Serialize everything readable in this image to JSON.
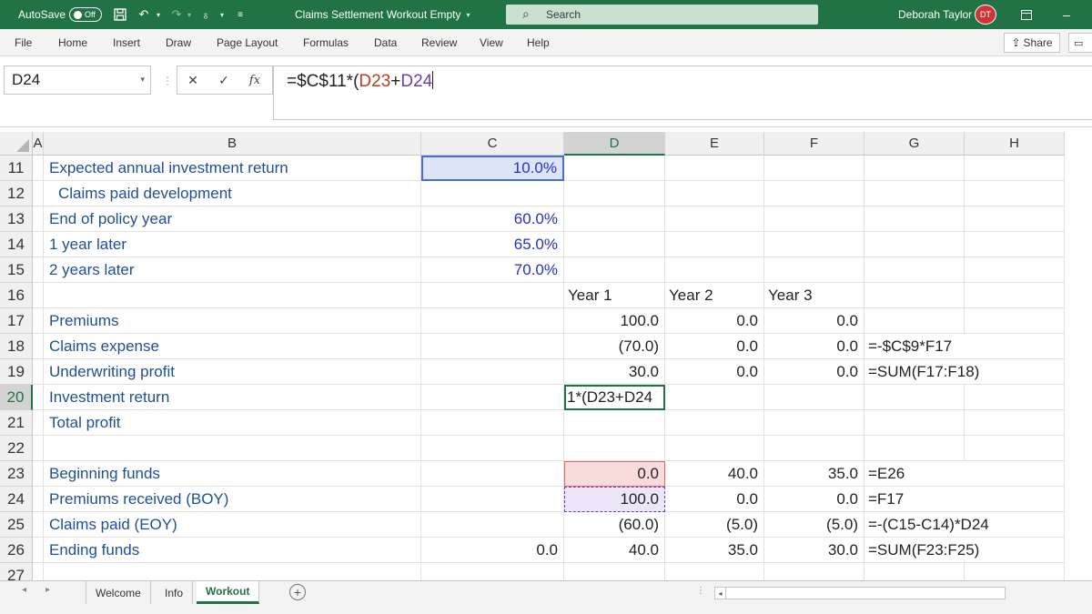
{
  "title_bar": {
    "autosave_label": "AutoSave",
    "autosave_state": "Off",
    "document_title": "Claims Settlement Workout Empty",
    "search_placeholder": "Search",
    "user_name": "Deborah Taylor",
    "user_initials": "DT"
  },
  "menu": {
    "items": [
      "File",
      "Home",
      "Insert",
      "Draw",
      "Page Layout",
      "Formulas",
      "Data",
      "Review",
      "View",
      "Help"
    ],
    "share_label": "Share"
  },
  "formula_bar": {
    "name_box": "D24",
    "formula_prefix": "=$C$11*(",
    "ref_a": "D23",
    "plus": "+",
    "ref_b": "D24"
  },
  "columns": [
    "A",
    "B",
    "C",
    "D",
    "E",
    "F",
    "G",
    "H"
  ],
  "rows": [
    {
      "num": "11",
      "b": "Expected annual investment return",
      "c": "10.0%",
      "d": "",
      "e": "",
      "f": "",
      "g": ""
    },
    {
      "num": "12",
      "b": "Claims paid development",
      "c": "",
      "d": "",
      "e": "",
      "f": "",
      "g": ""
    },
    {
      "num": "13",
      "b": "End of policy year",
      "c": "60.0%",
      "d": "",
      "e": "",
      "f": "",
      "g": ""
    },
    {
      "num": "14",
      "b": "1 year later",
      "c": "65.0%",
      "d": "",
      "e": "",
      "f": "",
      "g": ""
    },
    {
      "num": "15",
      "b": "2 years later",
      "c": "70.0%",
      "d": "",
      "e": "",
      "f": "",
      "g": ""
    },
    {
      "num": "16",
      "b": "",
      "c": "",
      "d": "Year 1",
      "e": "Year 2",
      "f": "Year 3",
      "g": ""
    },
    {
      "num": "17",
      "b": "Premiums",
      "c": "",
      "d": "100.0",
      "e": "0.0",
      "f": "0.0",
      "g": ""
    },
    {
      "num": "18",
      "b": "Claims expense",
      "c": "",
      "d": "(70.0)",
      "e": "0.0",
      "f": "0.0",
      "g": "=-$C$9*F17"
    },
    {
      "num": "19",
      "b": "Underwriting profit",
      "c": "",
      "d": "30.0",
      "e": "0.0",
      "f": "0.0",
      "g": "=SUM(F17:F18)"
    },
    {
      "num": "20",
      "b": "Investment return",
      "c": "",
      "d": "1*(D23+D24",
      "e": "",
      "f": "",
      "g": ""
    },
    {
      "num": "21",
      "b": "Total profit",
      "c": "",
      "d": "",
      "e": "",
      "f": "",
      "g": ""
    },
    {
      "num": "22",
      "b": "",
      "c": "",
      "d": "",
      "e": "",
      "f": "",
      "g": ""
    },
    {
      "num": "23",
      "b": "Beginning funds",
      "c": "",
      "d": "0.0",
      "e": "40.0",
      "f": "35.0",
      "g": "=E26"
    },
    {
      "num": "24",
      "b": "Premiums received (BOY)",
      "c": "",
      "d": "100.0",
      "e": "0.0",
      "f": "0.0",
      "g": "=F17"
    },
    {
      "num": "25",
      "b": "Claims paid (EOY)",
      "c": "",
      "d": "(60.0)",
      "e": "(5.0)",
      "f": "(5.0)",
      "g": "=-(C15-C14)*D24"
    },
    {
      "num": "26",
      "b": "Ending funds",
      "c": "0.0",
      "d": "40.0",
      "e": "35.0",
      "f": "30.0",
      "g": "=SUM(F23:F25)"
    },
    {
      "num": "27",
      "b": "",
      "c": "",
      "d": "",
      "e": "",
      "f": "",
      "g": ""
    }
  ],
  "sheet_tabs": [
    "Welcome",
    "Info",
    "Workout"
  ],
  "active_tab": "Workout"
}
